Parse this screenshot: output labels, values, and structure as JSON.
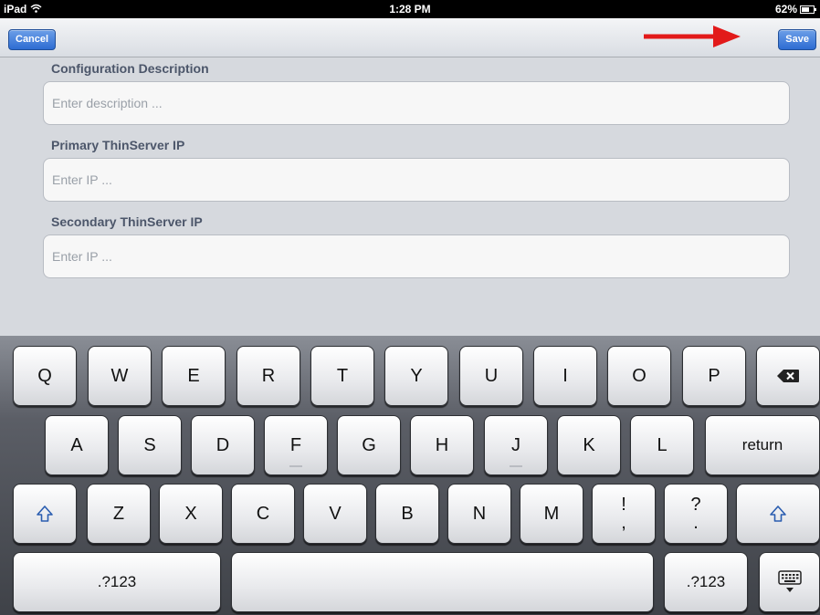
{
  "status_bar": {
    "device": "iPad",
    "time": "1:28 PM",
    "battery": "62%"
  },
  "nav": {
    "cancel_label": "Cancel",
    "save_label": "Save"
  },
  "form": {
    "fields": [
      {
        "label": "Configuration Description",
        "placeholder": "Enter description ..."
      },
      {
        "label": "Primary ThinServer IP",
        "placeholder": "Enter IP ..."
      },
      {
        "label": "Secondary ThinServer IP",
        "placeholder": "Enter IP ..."
      }
    ]
  },
  "keyboard": {
    "row1": [
      "Q",
      "W",
      "E",
      "R",
      "T",
      "Y",
      "U",
      "I",
      "O",
      "P"
    ],
    "row2": [
      "A",
      "S",
      "D",
      "F",
      "G",
      "H",
      "J",
      "K",
      "L"
    ],
    "row2_return": "return",
    "row3": [
      "Z",
      "X",
      "C",
      "V",
      "B",
      "N",
      "M"
    ],
    "row3_punct": [
      {
        "top": "!",
        "bottom": ","
      },
      {
        "top": "?",
        "bottom": "."
      }
    ],
    "numbers_label": ".?123",
    "icons": {
      "delete": "backspace-icon",
      "shift": "shift-icon",
      "hide": "keyboard-hide-icon"
    }
  },
  "annotation": {
    "arrow_color": "#e21a1a",
    "icon": "red-arrow-icon"
  }
}
